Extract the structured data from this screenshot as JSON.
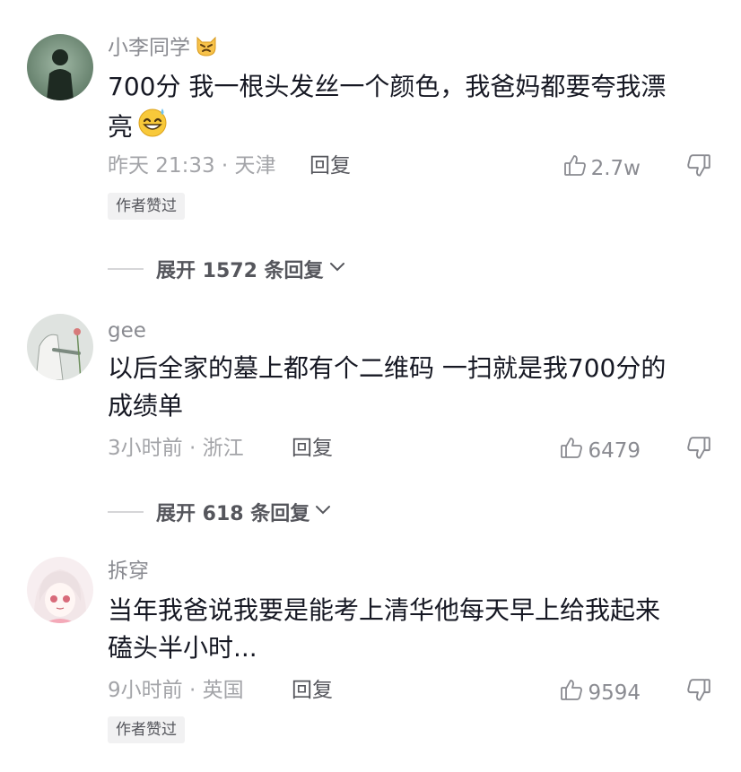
{
  "comments": [
    {
      "username": "小李同学",
      "username_emoji": "cat-emoji",
      "text_line1": "700分 我一根头发丝一个颜色，我爸妈都要夸我漂",
      "text_line2": "亮",
      "text_emoji": "grin-sweat-emoji",
      "meta": "昨天 21:33 · 天津",
      "reply_label": "回复",
      "likes": "2.7w",
      "badge": "作者赞过",
      "expand_label": "展开 1572 条回复"
    },
    {
      "username": "gee",
      "text_line1": "以后全家的墓上都有个二维码 一扫就是我700分的",
      "text_line2": "成绩单",
      "meta": "3小时前 · 浙江",
      "reply_label": "回复",
      "likes": "6479",
      "expand_label": "展开 618 条回复"
    },
    {
      "username": "拆穿",
      "text_line1": "当年我爸说我要是能考上清华他每天早上给我起来",
      "text_line2": "磕头半小时...",
      "meta": "9小时前 · 英国",
      "reply_label": "回复",
      "likes": "9594",
      "badge": "作者赞过"
    }
  ],
  "icons": {
    "like": "thumbs-up-icon",
    "dislike": "thumbs-down-icon",
    "expand": "chevron-down-icon"
  }
}
